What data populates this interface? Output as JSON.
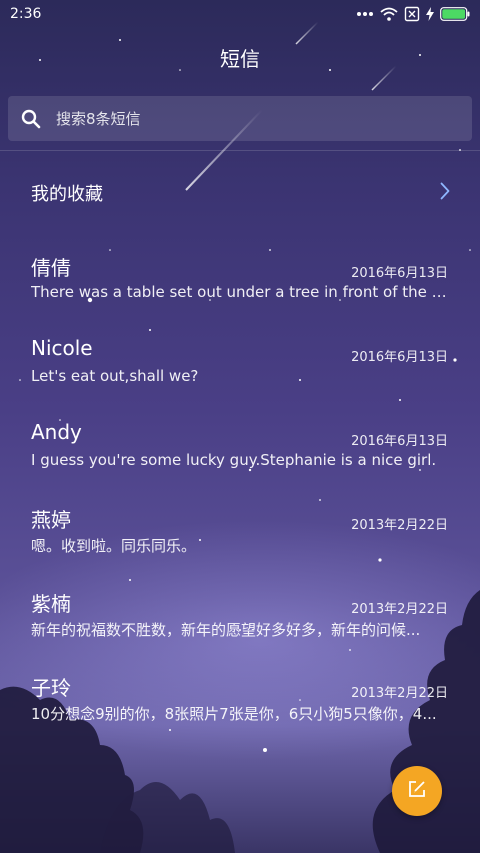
{
  "status_bar": {
    "time": "2:36",
    "icons": [
      "more-dots-icon",
      "wifi-icon",
      "sim-off-icon",
      "charging-bolt-icon",
      "battery-icon"
    ]
  },
  "header": {
    "title": "短信"
  },
  "search": {
    "placeholder": "搜索8条短信"
  },
  "favorites": {
    "label": "我的收藏"
  },
  "conversations": [
    {
      "name": "倩倩",
      "date": "2016年6月13日",
      "preview": "There was a table set out under a tree in front of the ho..."
    },
    {
      "name": "Nicole",
      "date": "2016年6月13日",
      "preview": "Let's eat out,shall we?"
    },
    {
      "name": "Andy",
      "date": "2016年6月13日",
      "preview": "I guess you're some lucky guy.Stephanie is a nice girl."
    },
    {
      "name": "燕婷",
      "date": "2013年2月22日",
      "preview": "嗯。收到啦。同乐同乐。"
    },
    {
      "name": "紫楠",
      "date": "2013年2月22日",
      "preview": "新年的祝福数不胜数，新年的愿望好多好多，新年的问候..."
    },
    {
      "name": "子玲",
      "date": "2013年2月22日",
      "preview": "10分想念9别的你，8张照片7张是你，6只小狗5只像你，4..."
    }
  ],
  "colors": {
    "accent_compose": "#f4a623",
    "battery": "#4cd964",
    "background_top": "#2c2a5a",
    "background_bottom": "#6f67ad"
  }
}
